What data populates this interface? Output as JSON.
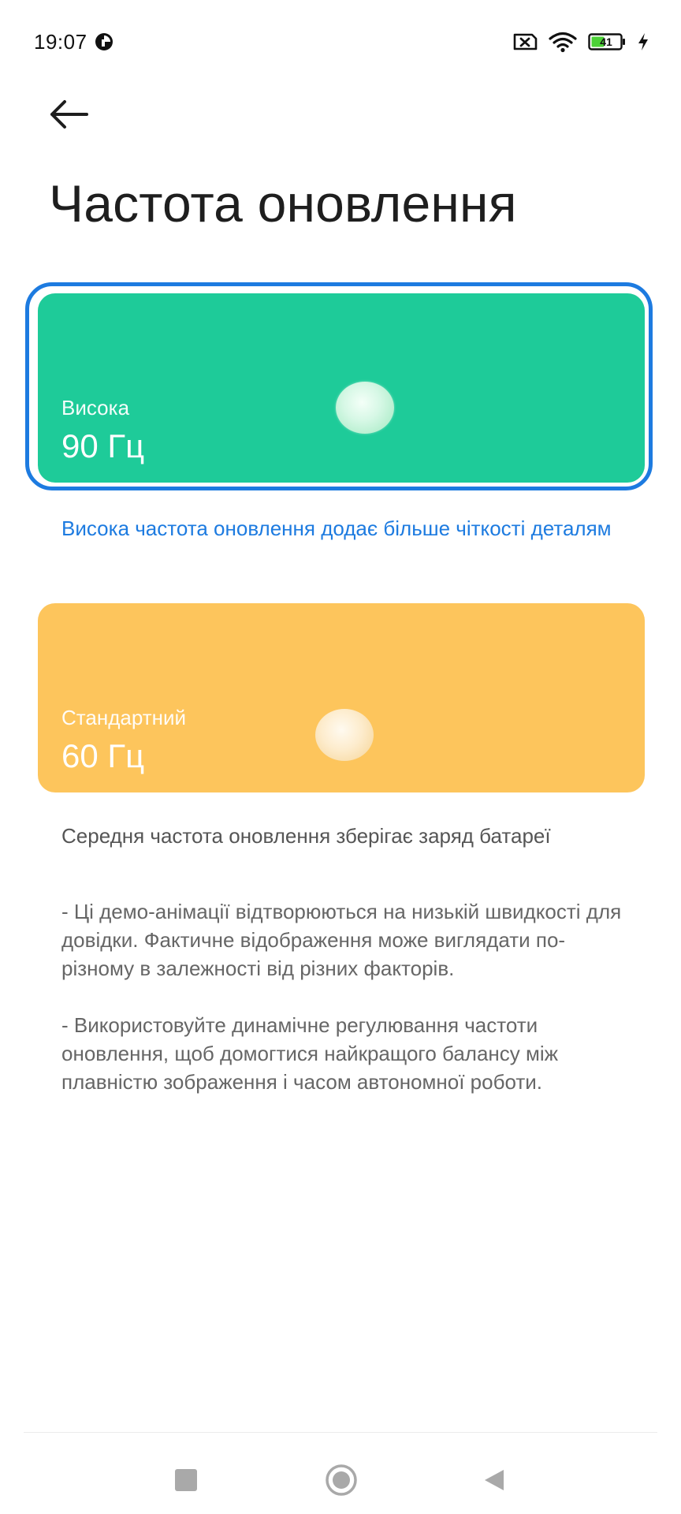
{
  "status_bar": {
    "time": "19:07",
    "battery_level": "41",
    "icons": [
      "app-notification-icon",
      "sim-off-icon",
      "wifi-icon",
      "battery-icon",
      "charging-bolt-icon"
    ]
  },
  "header": {
    "back_icon": "arrow-left-icon",
    "title": "Частота оновлення"
  },
  "options": [
    {
      "name": "Висока",
      "rate": "90 Гц",
      "description": "Висока частота оновлення додає більше чіткості деталям",
      "selected": true,
      "color": "#1ecb99"
    },
    {
      "name": "Стандартний",
      "rate": "60 Гц",
      "description": "Середня частота оновлення зберігає заряд батареї",
      "selected": false,
      "color": "#fdc55c"
    }
  ],
  "notes": [
    "- Ці демо-анімації відтворюються на низькій швидкості для довідки. Фактичне відображення може виглядати по-різному в залежності від різних факторів.",
    "- Використовуйте динамічне регулювання частоти оновлення, щоб домогтися найкращого балансу між плавністю зображення і часом автономної роботи."
  ],
  "colors": {
    "accent": "#1d7be0",
    "high_card": "#1ecb99",
    "standard_card": "#fdc55c"
  },
  "nav_bar": {
    "icons": [
      "recents-square-icon",
      "home-circle-icon",
      "back-triangle-icon"
    ]
  }
}
